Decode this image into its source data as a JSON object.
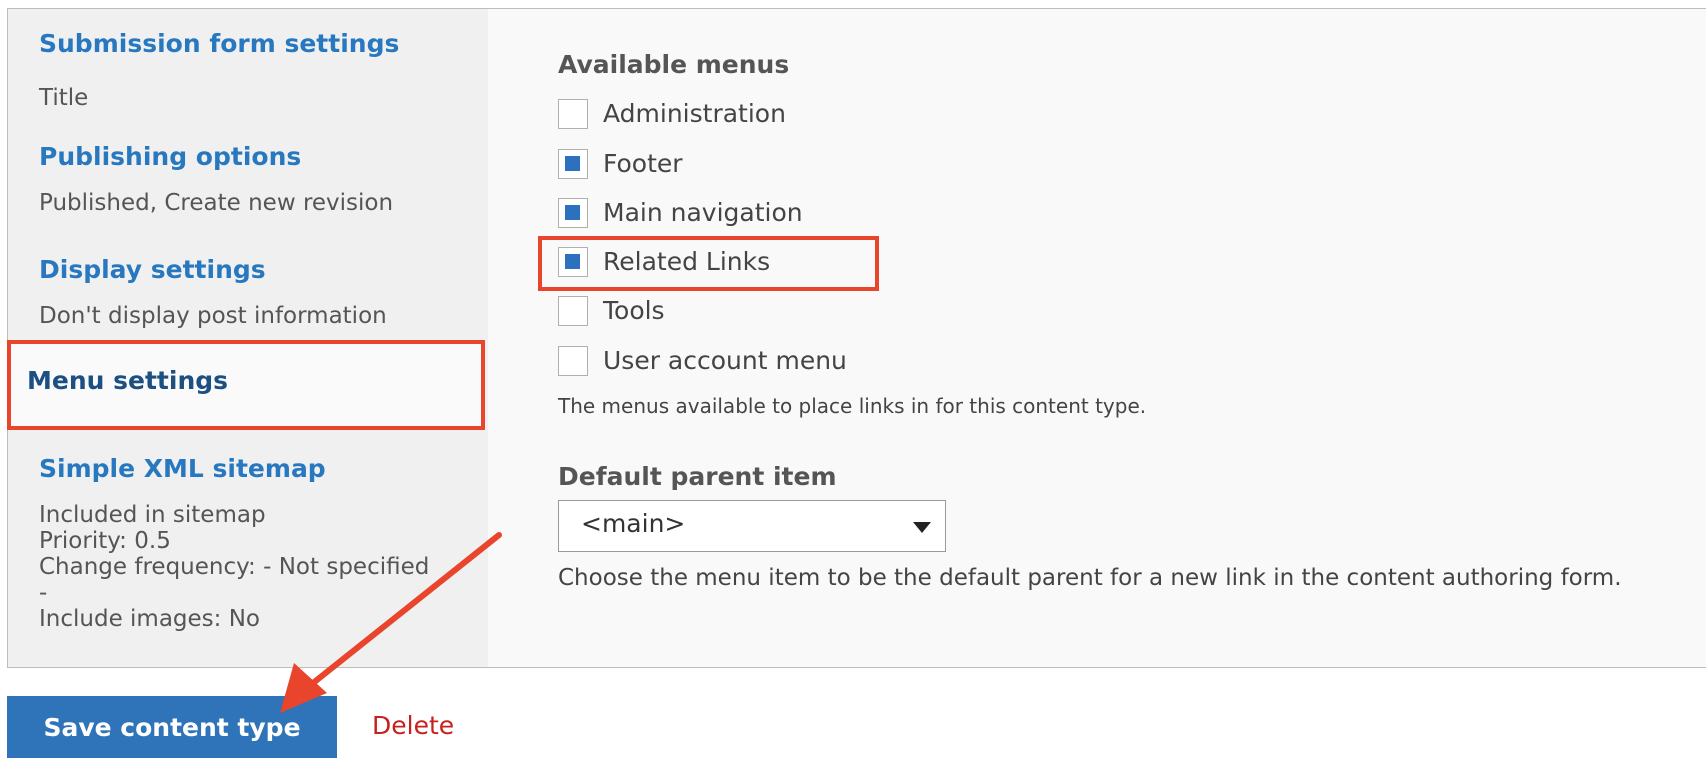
{
  "vertical_tabs": [
    {
      "title": "Submission form settings",
      "summary": [
        "Title"
      ]
    },
    {
      "title": "Publishing options",
      "summary": [
        "Published, Create new revision"
      ]
    },
    {
      "title": "Display settings",
      "summary": [
        "Don't display post information"
      ]
    },
    {
      "title": "Menu settings",
      "summary": []
    },
    {
      "title": "Simple XML sitemap",
      "summary": [
        "Included in sitemap",
        "Priority: 0.5",
        "Change frequency: - Not specified",
        "-",
        "Include images: No"
      ]
    }
  ],
  "menu_settings": {
    "available_menus_label": "Available menus",
    "menus": [
      {
        "label": "Administration",
        "checked": false
      },
      {
        "label": "Footer",
        "checked": true
      },
      {
        "label": "Main navigation",
        "checked": true
      },
      {
        "label": "Related Links",
        "checked": true
      },
      {
        "label": "Tools",
        "checked": false
      },
      {
        "label": "User account menu",
        "checked": false
      }
    ],
    "menus_description": "The menus available to place links in for this content type.",
    "default_parent_label": "Default parent item",
    "default_parent_value": "<main>",
    "default_parent_description": "Choose the menu item to be the default parent for a new link in the content authoring form."
  },
  "actions": {
    "save_label": "Save content type",
    "delete_label": "Delete"
  },
  "colors": {
    "link_blue": "#2878c0",
    "active_tab_blue": "#1c4f82",
    "highlight_red": "#e8452c",
    "checkbox_blue": "#2b71bd",
    "button_blue": "#2f73b8",
    "delete_red": "#c8201e"
  }
}
